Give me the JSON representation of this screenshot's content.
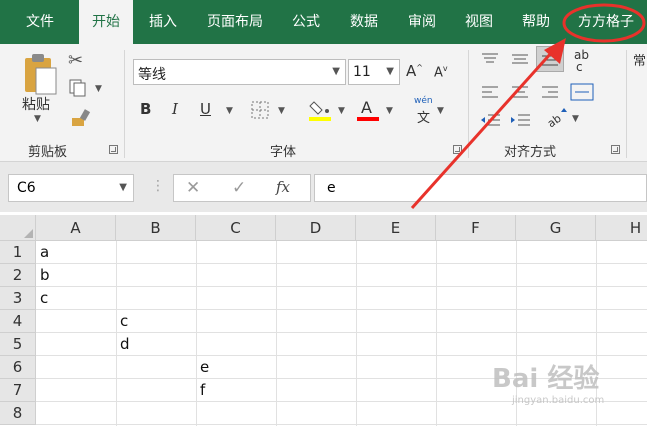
{
  "tabs": [
    "文件",
    "开始",
    "插入",
    "页面布局",
    "公式",
    "数据",
    "审阅",
    "视图",
    "帮助",
    "方方格子"
  ],
  "clipboard": {
    "paste_label": "粘贴",
    "group_label": "剪贴板"
  },
  "font": {
    "name": "等线",
    "size": "11",
    "group_label": "字体",
    "bold": "B",
    "italic": "I",
    "underline": "U",
    "phonetic_top": "wén",
    "phonetic_bottom": "文"
  },
  "alignment": {
    "group_label": "对齐方式",
    "wrap_top": "ab",
    "wrap_bottom": "c"
  },
  "formula_bar": {
    "name_box": "C6",
    "fx": "fx",
    "value": "e"
  },
  "columns": [
    "A",
    "B",
    "C",
    "D",
    "E",
    "F",
    "G",
    "H"
  ],
  "rows": [
    "1",
    "2",
    "3",
    "4",
    "5",
    "6",
    "7",
    "8"
  ],
  "cells": [
    {
      "ref": "A1",
      "value": "a"
    },
    {
      "ref": "A2",
      "value": "b"
    },
    {
      "ref": "A3",
      "value": "c"
    },
    {
      "ref": "B4",
      "value": "c"
    },
    {
      "ref": "B5",
      "value": "d"
    },
    {
      "ref": "C6",
      "value": "e"
    },
    {
      "ref": "C7",
      "value": "f"
    }
  ],
  "watermark": {
    "main": "Bai 经验",
    "sub": "jingyan.baidu.com"
  },
  "colors": {
    "theme": "#217346",
    "annotation": "#e8322b",
    "fill_swatch": "#ffff00",
    "font_swatch": "#ff0000"
  }
}
